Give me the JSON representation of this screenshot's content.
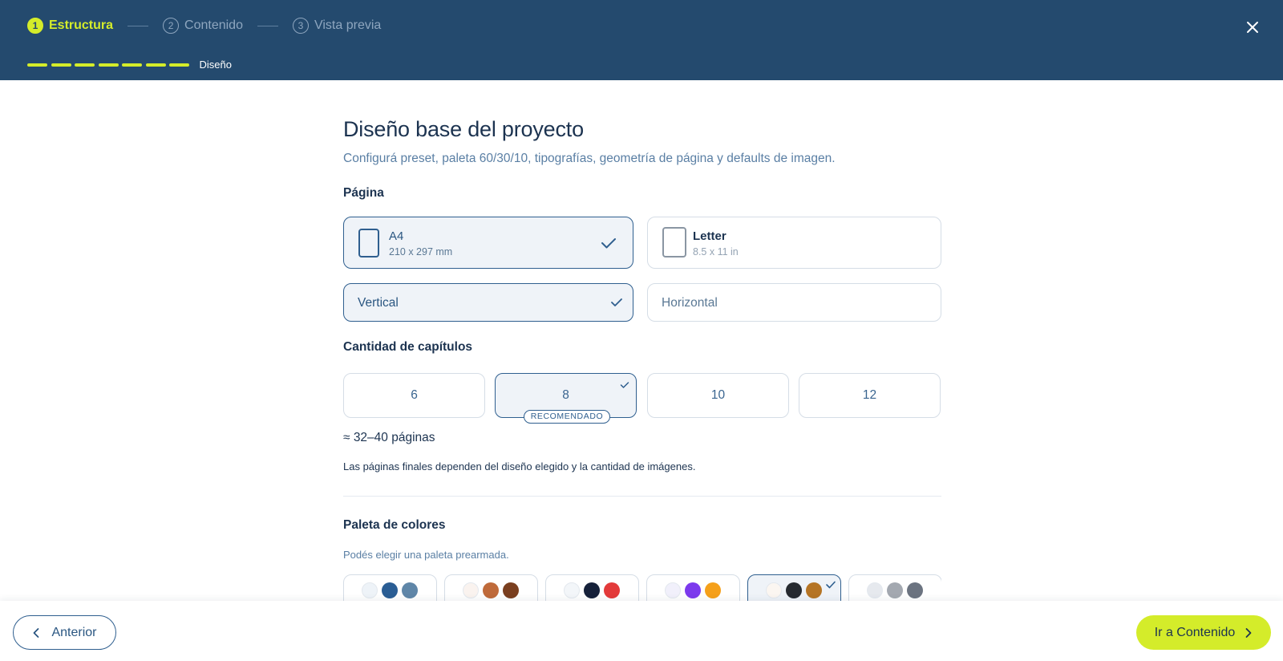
{
  "header": {
    "steps": [
      {
        "num": "1",
        "label": "Estructura"
      },
      {
        "num": "2",
        "label": "Contenido"
      },
      {
        "num": "3",
        "label": "Vista previa"
      }
    ],
    "active_step": 1,
    "progress_segments": 7,
    "progress_label": "Diseño",
    "close_icon": "close-icon"
  },
  "main": {
    "title": "Diseño base del proyecto",
    "subtitle": "Configurá preset, paleta 60/30/10, tipografías, geometría de página y defaults de imagen.",
    "page_section": {
      "label": "Página",
      "sizes": [
        {
          "name": "A4",
          "dims": "210 x 297 mm",
          "selected": true
        },
        {
          "name": "Letter",
          "dims": "8.5 x 11 in",
          "selected": false
        }
      ],
      "orientations": [
        {
          "label": "Vertical",
          "selected": true
        },
        {
          "label": "Horizontal",
          "selected": false
        }
      ]
    },
    "chapters_section": {
      "label": "Cantidad de capítulos",
      "options": [
        "6",
        "8",
        "10",
        "12"
      ],
      "selected": "8",
      "recommended_badge": "RECOMENDADO",
      "pages_estimate": "≈ 32–40 páginas",
      "pages_note": "Las páginas finales dependen del diseño elegido y la cantidad de imágenes."
    },
    "palette_section": {
      "label": "Paleta de colores",
      "hint": "Podés elegir una paleta prearmada.",
      "palettes": [
        {
          "colors": [
            "#eef3f8",
            "#2a5d94",
            "#5f86a8"
          ],
          "selected": false
        },
        {
          "colors": [
            "#faf3ef",
            "#bf6a3a",
            "#7a3f1f"
          ],
          "selected": false
        },
        {
          "colors": [
            "#f3f6f9",
            "#16213a",
            "#e33a3a"
          ],
          "selected": false
        },
        {
          "colors": [
            "#f1f0fb",
            "#7c3aed",
            "#f5a01a"
          ],
          "selected": false
        },
        {
          "colors": [
            "#fbf6f1",
            "#262a30",
            "#b57424"
          ],
          "selected": true
        },
        {
          "colors": [
            "#e6e9ee",
            "#a3a8b0",
            "#6b7380"
          ],
          "selected": false
        }
      ]
    }
  },
  "footer": {
    "prev_label": "Anterior",
    "next_label": "Ir a Contenido"
  },
  "colors": {
    "header_bg": "#244a6e",
    "accent": "#d4ec2a",
    "primary": "#2f5f8f"
  }
}
